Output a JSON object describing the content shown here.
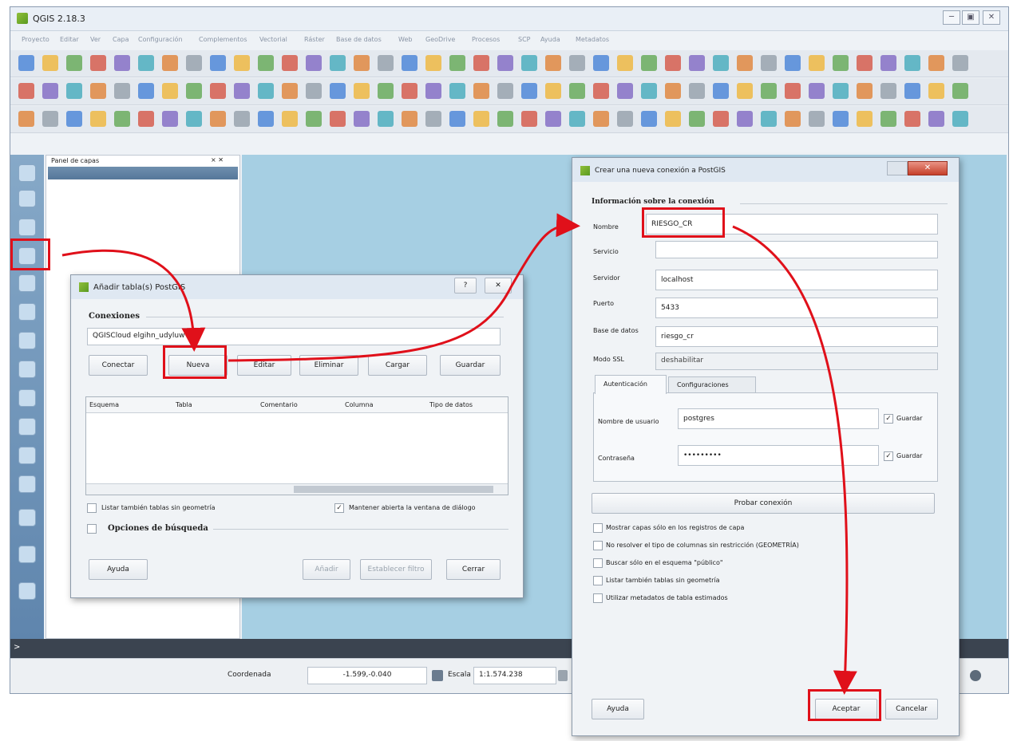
{
  "app": {
    "title": "QGIS 2.18.3"
  },
  "menu": [
    "Proyecto",
    "Editar",
    "Ver",
    "Capa",
    "Configuración",
    "Complementos",
    "Vectorial",
    "Ráster",
    "Base de datos",
    "Web",
    "GeoDrive",
    "Procesos",
    "SCP",
    "Ayuda",
    "Metadatos"
  ],
  "layers_panel": {
    "title": "Panel de capas",
    "close": "× ✕"
  },
  "status": {
    "coord_label": "Coordenada",
    "coord_value": "-1.599,-0.040",
    "scale_label": "Escala",
    "scale_value": "1:1.574.238"
  },
  "add_dialog": {
    "title": "Añadir tabla(s) PostGIS",
    "help_icon": "?",
    "close_icon": "✕",
    "connections_label": "Conexiones",
    "connection_value": "QGISCloud elgihn_udyluw",
    "buttons": {
      "connect": "Conectar",
      "new": "Nueva",
      "edit": "Editar",
      "delete": "Eliminar",
      "load": "Cargar",
      "save": "Guardar"
    },
    "columns": [
      "Esquema",
      "Tabla",
      "Comentario",
      "Columna",
      "Tipo de datos"
    ],
    "list_no_geom": "Listar también tablas sin geometría",
    "keep_open": "Mantener abierta la ventana de diálogo",
    "search_options": "Opciones de búsqueda",
    "help": "Ayuda",
    "add": "Añadir",
    "set_filter": "Establecer filtro",
    "close": "Cerrar"
  },
  "new_conn_dialog": {
    "title": "Crear una nueva conexión a PostGIS",
    "section": "Información sobre la conexión",
    "fields": {
      "name_label": "Nombre",
      "name_value": "RIESGO_CR",
      "service_label": "Servicio",
      "service_value": "",
      "host_label": "Servidor",
      "host_value": "localhost",
      "port_label": "Puerto",
      "port_value": "5433",
      "db_label": "Base de datos",
      "db_value": "riesgo_cr",
      "ssl_label": "Modo SSL",
      "ssl_value": "deshabilitar"
    },
    "tabs": [
      "Autenticación",
      "Configuraciones"
    ],
    "user_label": "Nombre de usuario",
    "user_value": "postgres",
    "password_label": "Contraseña",
    "password_value": "•••••••••",
    "save_label": "Guardar",
    "test_button": "Probar conexión",
    "options": [
      "Mostrar capas sólo en los registros de capa",
      "No resolver el tipo de columnas sin restricción (GEOMETRÍA)",
      "Buscar sólo en el esquema \"público\"",
      "Listar también tablas sin geometría",
      "Utilizar metadatos de tabla estimados"
    ],
    "help": "Ayuda",
    "accept": "Aceptar",
    "cancel": "Cancelar"
  },
  "colors": {
    "highlight": "#e0101a",
    "canvas": "#a6cfe3",
    "sidebar": "#6e93b8"
  }
}
